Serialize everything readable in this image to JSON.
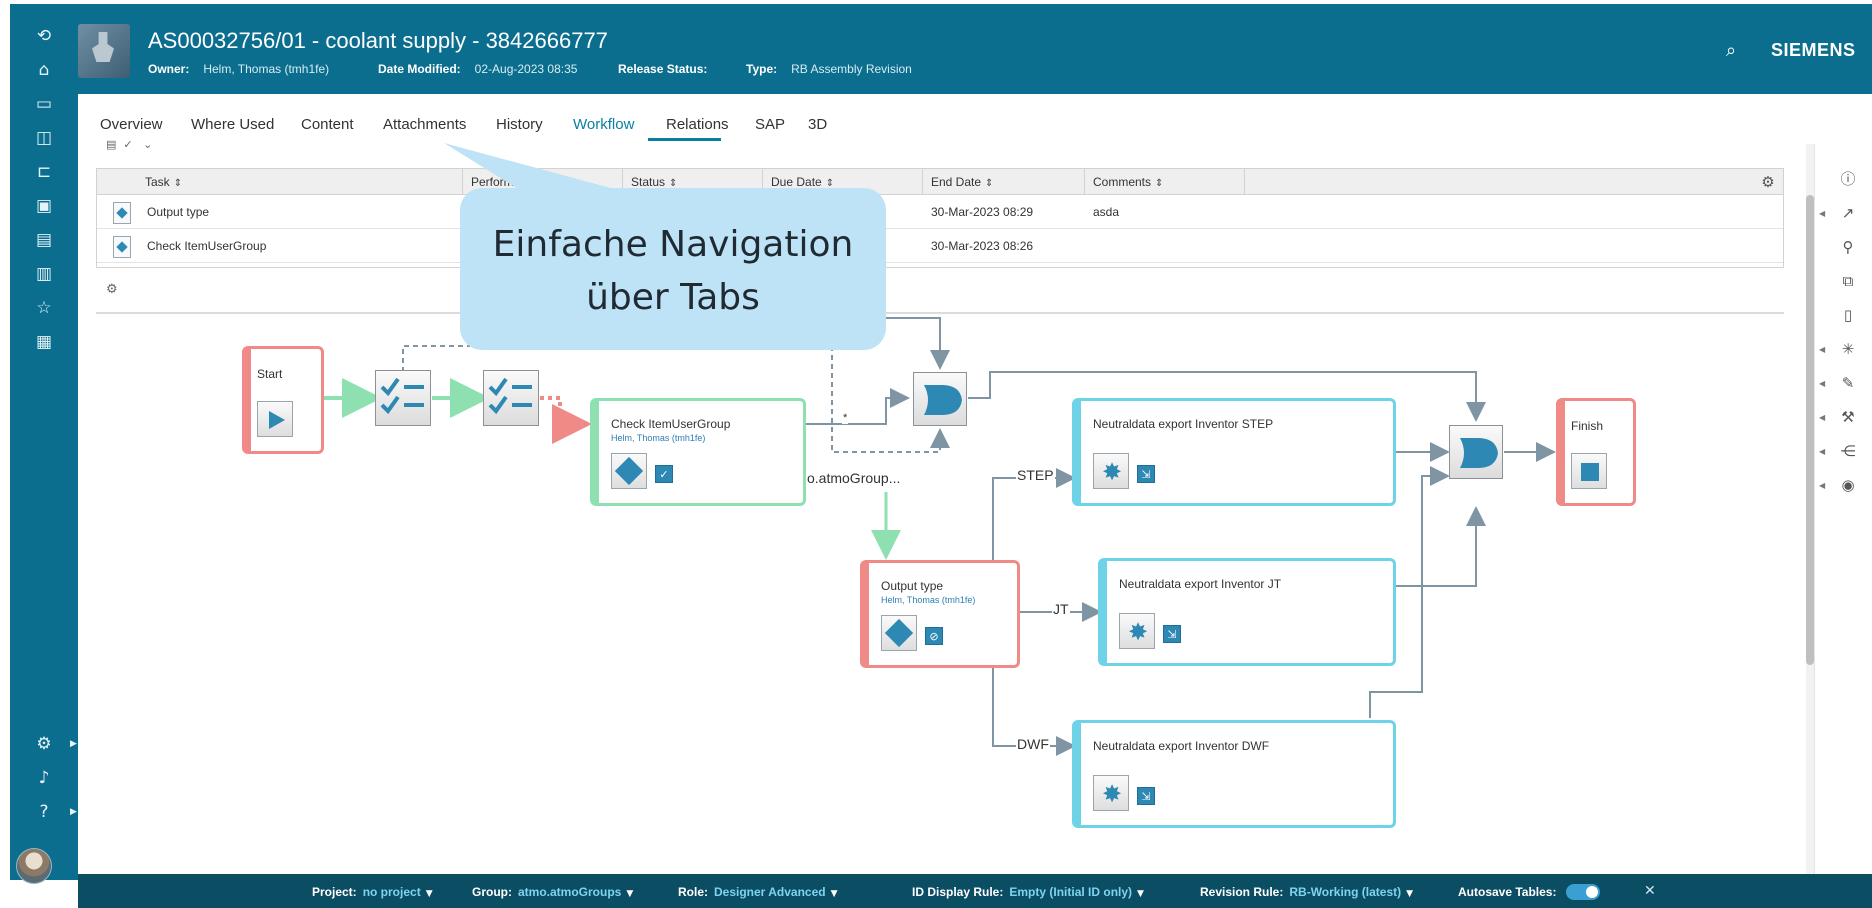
{
  "header": {
    "title": "AS00032756/01 - coolant supply - 3842666777",
    "owner_label": "Owner:",
    "owner_value": "Helm, Thomas (tmh1fe)",
    "date_label": "Date Modified:",
    "date_value": "02-Aug-2023 08:35",
    "release_label": "Release Status:",
    "type_label": "Type:",
    "type_value": "RB Assembly Revision",
    "brand": "SIEMENS",
    "search_icon": "search-icon"
  },
  "tabs": [
    {
      "label": "Overview"
    },
    {
      "label": "Where Used"
    },
    {
      "label": "Content"
    },
    {
      "label": "Attachments"
    },
    {
      "label": "History"
    },
    {
      "label": "Workflow",
      "active": true
    },
    {
      "label": "Relations"
    },
    {
      "label": "SAP"
    },
    {
      "label": "3D"
    }
  ],
  "table": {
    "columns": [
      "Task",
      "Performer",
      "Status",
      "Due Date",
      "End Date",
      "Comments"
    ],
    "rows": [
      {
        "task": "Output type",
        "end_date": "30-Mar-2023 08:29",
        "comments": "asda"
      },
      {
        "task": "Check ItemUserGroup",
        "end_date": "30-Mar-2023 08:26",
        "comments": ""
      }
    ]
  },
  "callout": {
    "line1": "Einfache Navigation",
    "line2": "über Tabs"
  },
  "workflow": {
    "start": "Start",
    "finish": "Finish",
    "check": {
      "title": "Check ItemUserGroup",
      "assignee": "Helm, Thomas (tmh1fe)"
    },
    "output": {
      "title": "Output type",
      "assignee": "Helm, Thomas (tmh1fe)"
    },
    "step": "Neutraldata export Inventor STEP",
    "jt": "Neutraldata export Inventor JT",
    "dwf": "Neutraldata export Inventor DWF",
    "edge_atmo": "o.atmoGroup...",
    "edge_step": "STEP",
    "edge_jt": "JT",
    "edge_dwf": "DWF",
    "edge_star": "*"
  },
  "footer": {
    "project_label": "Project:",
    "project_value": "no project",
    "group_label": "Group:",
    "group_value": "atmo.atmoGroups",
    "role_label": "Role:",
    "role_value": "Designer Advanced",
    "id_label": "ID Display Rule:",
    "id_value": "Empty (Initial ID only)",
    "revision_label": "Revision Rule:",
    "revision_value": "RB-Working (latest)",
    "autosave_label": "Autosave Tables:",
    "autosave_on": true
  },
  "colors": {
    "header": "#0b6e8e",
    "accent": "#0b7fa2",
    "footer": "#0b4e63",
    "callout": "#bfe3f6",
    "node_red": "#f08a86",
    "node_green": "#8ee0b0",
    "node_cyan": "#6fd3e8"
  }
}
